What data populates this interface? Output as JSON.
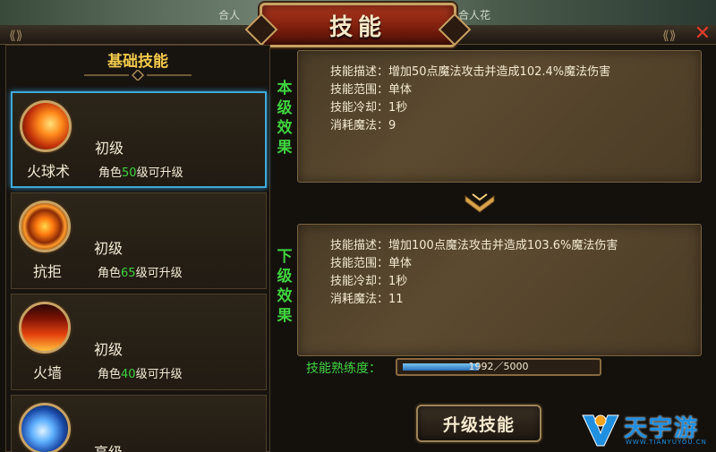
{
  "title": "技能",
  "background_labels": [
    "合人",
    "合人花"
  ],
  "left_panel": {
    "header": "基础技能",
    "skills": [
      {
        "name": "火球术",
        "level": "初级",
        "req_prefix": "角色",
        "req_level": "50",
        "req_suffix": "级可升级",
        "selected": true,
        "icon": "fireball-icon"
      },
      {
        "name": "抗拒",
        "level": "初级",
        "req_prefix": "角色",
        "req_level": "65",
        "req_suffix": "级可升级",
        "selected": false,
        "icon": "repel-icon"
      },
      {
        "name": "火墙",
        "level": "初级",
        "req_prefix": "角色",
        "req_level": "40",
        "req_suffix": "级可升级",
        "selected": false,
        "icon": "firewall-icon"
      },
      {
        "name": "",
        "level": "高级",
        "req_prefix": "",
        "req_level": "",
        "req_suffix": "",
        "selected": false,
        "icon": "lightning-icon"
      }
    ]
  },
  "current_effect": {
    "label": "本级效果",
    "lines": [
      "技能描述：增加50点魔法攻击并造成102.4%魔法伤害",
      "技能范围：单体",
      "技能冷却：1秒",
      "消耗魔法：9"
    ]
  },
  "next_effect": {
    "label": "下级效果",
    "lines": [
      "技能描述：增加100点魔法攻击并造成103.6%魔法伤害",
      "技能范围：单体",
      "技能冷却：1秒",
      "消耗魔法：11"
    ]
  },
  "proficiency": {
    "label": "技能熟练度：",
    "text": "1992／5000",
    "current": 1992,
    "max": 5000
  },
  "upgrade_button": "升级技能",
  "watermark": {
    "text": "天宇游",
    "sub": "WWW.TIANYUYOU.CN"
  },
  "colors": {
    "green_text": "#3fd33f",
    "gold_header": "#f2c94c",
    "title_red": "#b23a20",
    "selected_border": "#3fa9d8"
  }
}
